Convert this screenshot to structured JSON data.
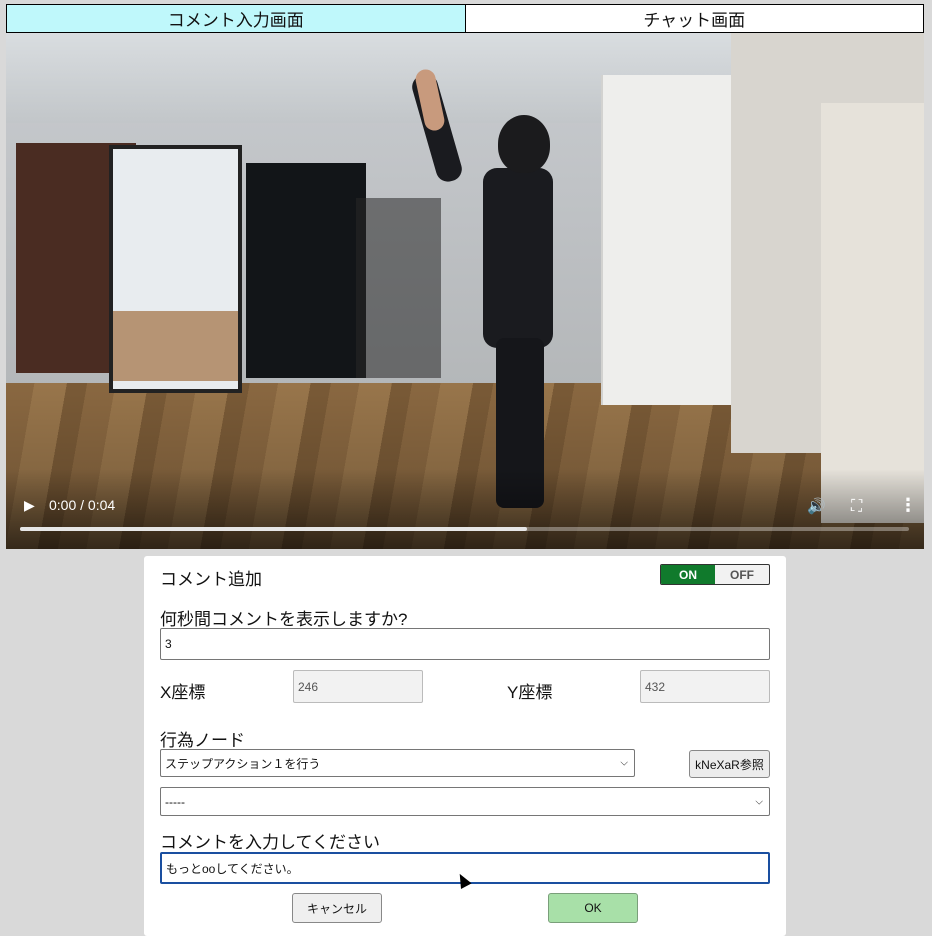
{
  "tabs": [
    {
      "label": "コメント入力画面",
      "active": true
    },
    {
      "label": "チャット画面",
      "active": false
    }
  ],
  "video": {
    "play_icon": "play-icon",
    "time": "0:00 / 0:04",
    "progress_fraction": 0.57,
    "volume_icon": "volume-icon",
    "fullscreen_icon": "fullscreen-icon",
    "more_icon": "more-vert-icon"
  },
  "form": {
    "title": "コメント追加",
    "toggle": {
      "on_label": "ON",
      "off_label": "OFF",
      "state": "on",
      "on_color": "#107a2c"
    },
    "duration_label": "何秒間コメントを表示しますか?",
    "duration_value": "3",
    "x_label": "X座標",
    "x_value": "246",
    "y_label": "Y座標",
    "y_value": "432",
    "action_label": "行為ノード",
    "action_select": "ステップアクション１を行う",
    "ref_button": "kNeXaR参照",
    "sub_select": "-----",
    "comment_label": "コメントを入力してください",
    "comment_value": "もっとooしてください。",
    "cancel_button": "キャンセル",
    "ok_button": "OK",
    "ok_color": "#a8e0a8"
  }
}
